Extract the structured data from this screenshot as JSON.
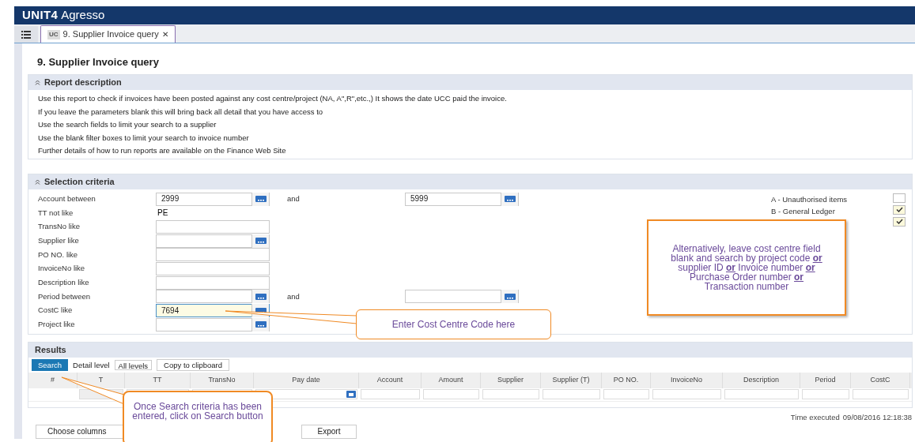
{
  "app": {
    "brand": "UNIT4",
    "product": "Agresso"
  },
  "tabs": [
    {
      "badge": "UC",
      "label": "9. Supplier Invoice query",
      "close": "✕",
      "selected": true
    }
  ],
  "page_title": "9. Supplier Invoice query",
  "report_description": {
    "title": "Report description",
    "expanded": true,
    "lines": [
      "Use this report to check if invoices have been posted against any cost centre/project (NA, A\",R\",etc.,) It shows the date UCC paid the invoice.",
      "If you leave the parameters blank this will bring back all detail that you have access to",
      "Use the search fields to limit your search to a supplier",
      "Use the blank filter boxes to limit your search to invoice number",
      "Further details of how to run reports are available on the Finance Web Site"
    ]
  },
  "selection_criteria": {
    "title": "Selection criteria",
    "expanded": true,
    "fields": [
      {
        "label": "Account between",
        "kind": "range",
        "value": "2999",
        "and": "and",
        "value2": "5999",
        "active": false
      },
      {
        "label": "TT not like",
        "kind": "static",
        "value": "PE",
        "active": false
      },
      {
        "label": "TransNo like",
        "kind": "text",
        "active": false
      },
      {
        "label": "Supplier like",
        "kind": "lookup",
        "active": false
      },
      {
        "label": "PO NO. like",
        "kind": "text",
        "active": false
      },
      {
        "label": "InvoiceNo like",
        "kind": "text",
        "active": false
      },
      {
        "label": "Description like",
        "kind": "text",
        "active": false
      },
      {
        "label": "Period between",
        "kind": "range",
        "and": "and",
        "active": false
      },
      {
        "label": "CostC like",
        "kind": "lookup",
        "value": "7694",
        "active": true
      },
      {
        "label": "Project like",
        "kind": "lookup",
        "active": false
      }
    ],
    "checkboxes": [
      {
        "label": "A - Unauthorised items",
        "checked": false
      },
      {
        "label": "B - General Ledger",
        "checked": true
      },
      {
        "checked": true
      }
    ]
  },
  "results": {
    "title": "Results",
    "toolbar": [
      "Search",
      "Detail level",
      "All levels",
      "Copy to clipboard"
    ],
    "columns": [
      "#",
      "T",
      "TT",
      "TransNo",
      "Pay date",
      "Account",
      "Amount",
      "Supplier",
      "Supplier (T)",
      "PO NO.",
      "InvoiceNo",
      "Description",
      "Period",
      "CostC"
    ],
    "time_label": "Time executed",
    "time_value": "09/08/2016 12:18:38"
  },
  "bottom_buttons": [
    "Choose columns",
    "Export"
  ],
  "callouts": [
    {
      "text": "Enter Cost Centre Code here"
    },
    {
      "text": "Alternatively, leave cost centre field blank and search by project code **or** supplier ID **or** Invoice number **or** Purchase Order number **or** Transaction number"
    },
    {
      "text": "Once Search criteria has been entered, click on Search button"
    }
  ]
}
